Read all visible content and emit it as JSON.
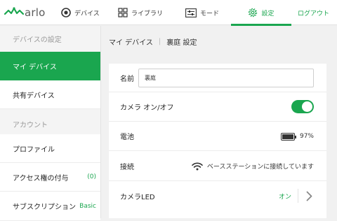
{
  "nav": {
    "logo_text": "arlo",
    "items": [
      {
        "label": "デバイス",
        "icon": "camera-icon"
      },
      {
        "label": "ライブラリ",
        "icon": "grid-icon"
      },
      {
        "label": "モード",
        "icon": "sliders-icon"
      },
      {
        "label": "設定",
        "icon": "gear-icon"
      }
    ],
    "logout_label": "ログアウト"
  },
  "sidebar": {
    "section_devices": "デバイスの設定",
    "my_devices": "マイ デバイス",
    "shared_devices": "共有デバイス",
    "section_account": "アカウント",
    "profile": "プロファイル",
    "grant_access": "アクセス権の付与",
    "grant_access_count": "(0)",
    "subscription": "サブスクリプション",
    "subscription_value": "Basic"
  },
  "breadcrumb": {
    "parent": "マイ デバイス",
    "separator": "|",
    "current": "裏庭 設定"
  },
  "settings": {
    "name_label": "名前",
    "name_value": "裏庭",
    "camera_label": "カメラ オン/オフ",
    "camera_on": true,
    "battery_label": "電池",
    "battery_value": "97%",
    "battery_level": 0.97,
    "connection_label": "接続",
    "connection_value": "ベースステーションに接続しています",
    "led_label": "カメラLED",
    "led_value": "オン"
  },
  "colors": {
    "accent": "#1aa64f",
    "background": "#f1f1f1"
  }
}
